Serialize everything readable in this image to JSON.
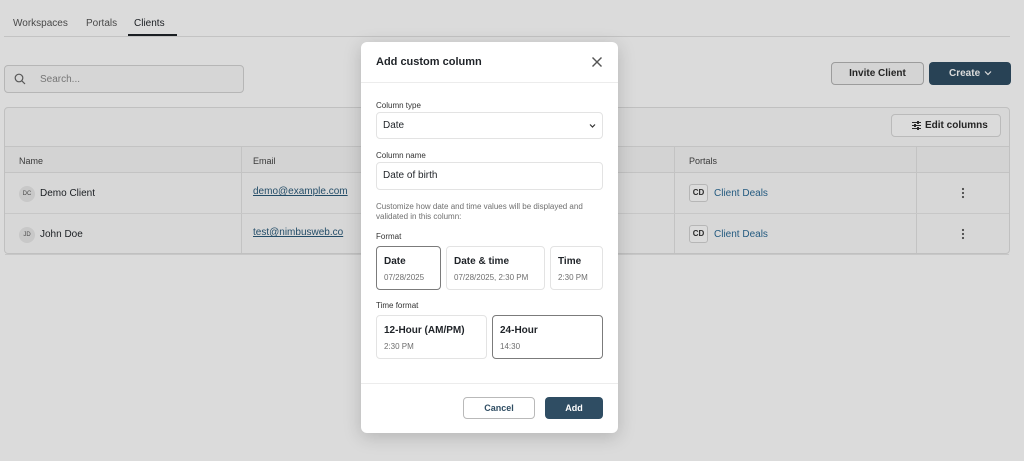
{
  "tabs": [
    {
      "label": "Workspaces"
    },
    {
      "label": "Portals"
    },
    {
      "label": "Clients",
      "active": true
    }
  ],
  "search": {
    "placeholder": "Search..."
  },
  "toolbar": {
    "invite_label": "Invite Client",
    "create_label": "Create"
  },
  "table": {
    "edit_columns_label": "Edit columns",
    "headers": [
      "Name",
      "Email",
      "Portals"
    ],
    "rows": [
      {
        "initials": "DC",
        "name": "Demo Client",
        "email": "demo@example.com",
        "portal_badge": "CD",
        "portal": "Client Deals"
      },
      {
        "initials": "JD",
        "name": "John Doe",
        "email": "test@nimbusweb.co",
        "portal_badge": "CD",
        "portal": "Client Deals"
      }
    ]
  },
  "modal": {
    "title": "Add custom column",
    "column_type_label": "Column type",
    "column_type_value": "Date",
    "column_name_label": "Column name",
    "column_name_value": "Date of birth",
    "help_text": "Customize how date and time values will be displayed and validated in this column:",
    "format_label": "Format",
    "format_options": [
      {
        "title": "Date",
        "example": "07/28/2025",
        "selected": true
      },
      {
        "title": "Date & time",
        "example": "07/28/2025, 2:30 PM",
        "selected": false
      },
      {
        "title": "Time",
        "example": "2:30 PM",
        "selected": false
      }
    ],
    "time_format_label": "Time format",
    "time_format_options": [
      {
        "title": "12-Hour (AM/PM)",
        "example": "2:30 PM",
        "selected": false
      },
      {
        "title": "24-Hour",
        "example": "14:30",
        "selected": true
      }
    ],
    "cancel_label": "Cancel",
    "add_label": "Add"
  },
  "colors": {
    "primary": "#2f4d63",
    "link": "#2a6a96"
  },
  "icons": [
    "search-icon",
    "chevron-down-icon",
    "sliders-icon",
    "kebab-menu-icon",
    "close-icon"
  ]
}
